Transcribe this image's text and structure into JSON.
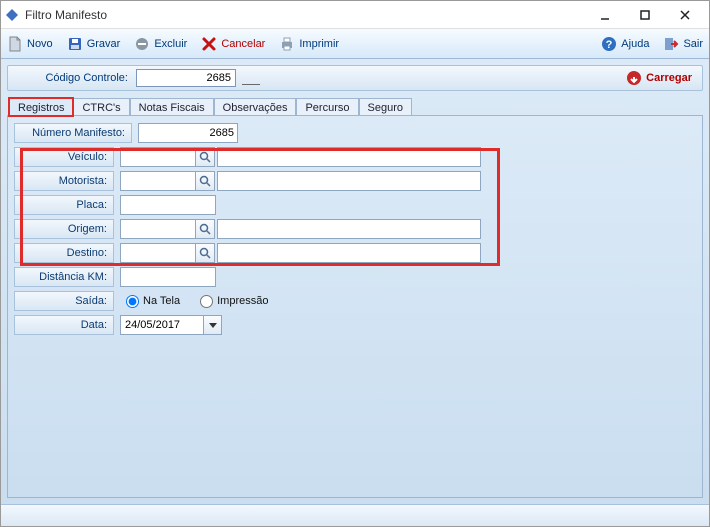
{
  "window": {
    "title": "Filtro Manifesto"
  },
  "toolbar": {
    "novo": "Novo",
    "gravar": "Gravar",
    "excluir": "Excluir",
    "cancelar": "Cancelar",
    "imprimir": "Imprimir",
    "ajuda": "Ajuda",
    "sair": "Sair"
  },
  "controle": {
    "label": "Código Controle:",
    "value": "2685",
    "carregar_label": "Carregar"
  },
  "tabs": {
    "registros": "Registros",
    "ctrcs": "CTRC's",
    "notas": "Notas Fiscais",
    "obs": "Observações",
    "percurso": "Percurso",
    "seguro": "Seguro"
  },
  "form": {
    "numero_manifesto_label": "Número Manifesto:",
    "numero_manifesto_value": "2685",
    "veiculo_label": "Veículo:",
    "veiculo_code": "",
    "veiculo_desc": "",
    "motorista_label": "Motorista:",
    "motorista_code": "",
    "motorista_desc": "",
    "placa_label": "Placa:",
    "placa_value": "",
    "origem_label": "Origem:",
    "origem_code": "",
    "origem_desc": "",
    "destino_label": "Destino:",
    "destino_code": "",
    "destino_desc": "",
    "distancia_label": "Distância KM:",
    "distancia_value": "",
    "saida_label": "Saída:",
    "saida_na_tela": "Na Tela",
    "saida_impressao": "Impressão",
    "saida_selected": "na_tela",
    "data_label": "Data:",
    "data_value": "24/05/2017"
  },
  "colors": {
    "accent_blue": "#003a7a",
    "warn_red": "#e02b2b"
  }
}
